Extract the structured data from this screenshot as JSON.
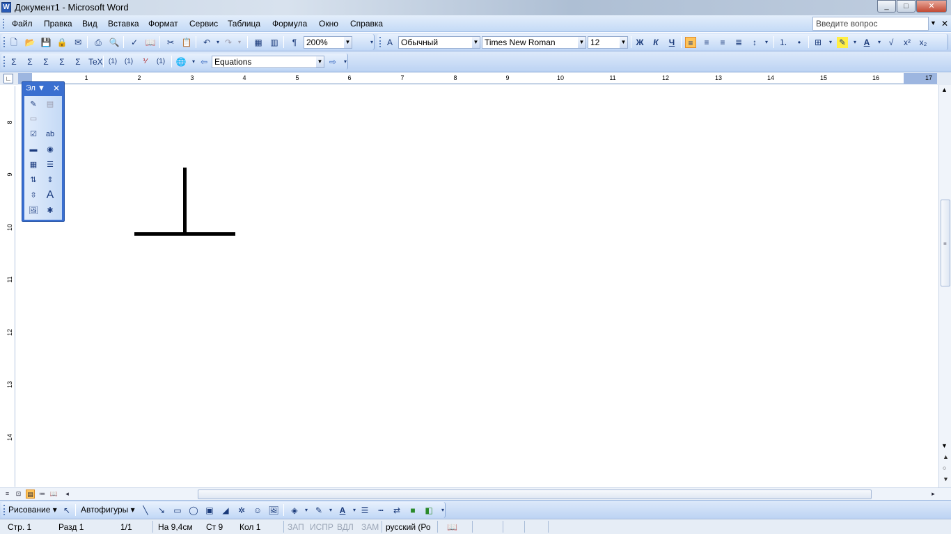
{
  "window": {
    "title": "Документ1 - Microsoft Word",
    "minimize": "_",
    "maximize": "□",
    "close": "✕"
  },
  "menu": {
    "items": [
      "Файл",
      "Правка",
      "Вид",
      "Вставка",
      "Формат",
      "Сервис",
      "Таблица",
      "Формула",
      "Окно",
      "Справка"
    ],
    "ask_placeholder": "Введите вопрос"
  },
  "standard_toolbar": {
    "zoom": "200%"
  },
  "formatting_toolbar": {
    "style": "Обычный",
    "font": "Times New Roman",
    "size": "12",
    "bold": "Ж",
    "italic": "К",
    "underline": "Ч"
  },
  "equation_toolbar": {
    "eq_style": "Equations"
  },
  "ruler": {
    "h_numbers": [
      "1",
      "2",
      "3",
      "4",
      "5",
      "6",
      "7",
      "8",
      "9",
      "10",
      "11",
      "12",
      "13",
      "14",
      "15",
      "16",
      "17"
    ],
    "v_numbers": [
      "8",
      "9",
      "10",
      "11",
      "12",
      "13",
      "14"
    ]
  },
  "forms_toolbar": {
    "title": "Эл",
    "close": "✕"
  },
  "drawing_toolbar": {
    "draw_label": "Рисование",
    "autoshapes_label": "Автофигуры"
  },
  "status": {
    "page": "Стр. 1",
    "section": "Разд 1",
    "pages": "1/1",
    "at": "На 9,4см",
    "line": "Ст 9",
    "col": "Кол 1",
    "rec": "ЗАП",
    "trk": "ИСПР",
    "ext": "ВДЛ",
    "ovr": "ЗАМ",
    "lang": "русский (Ро"
  }
}
